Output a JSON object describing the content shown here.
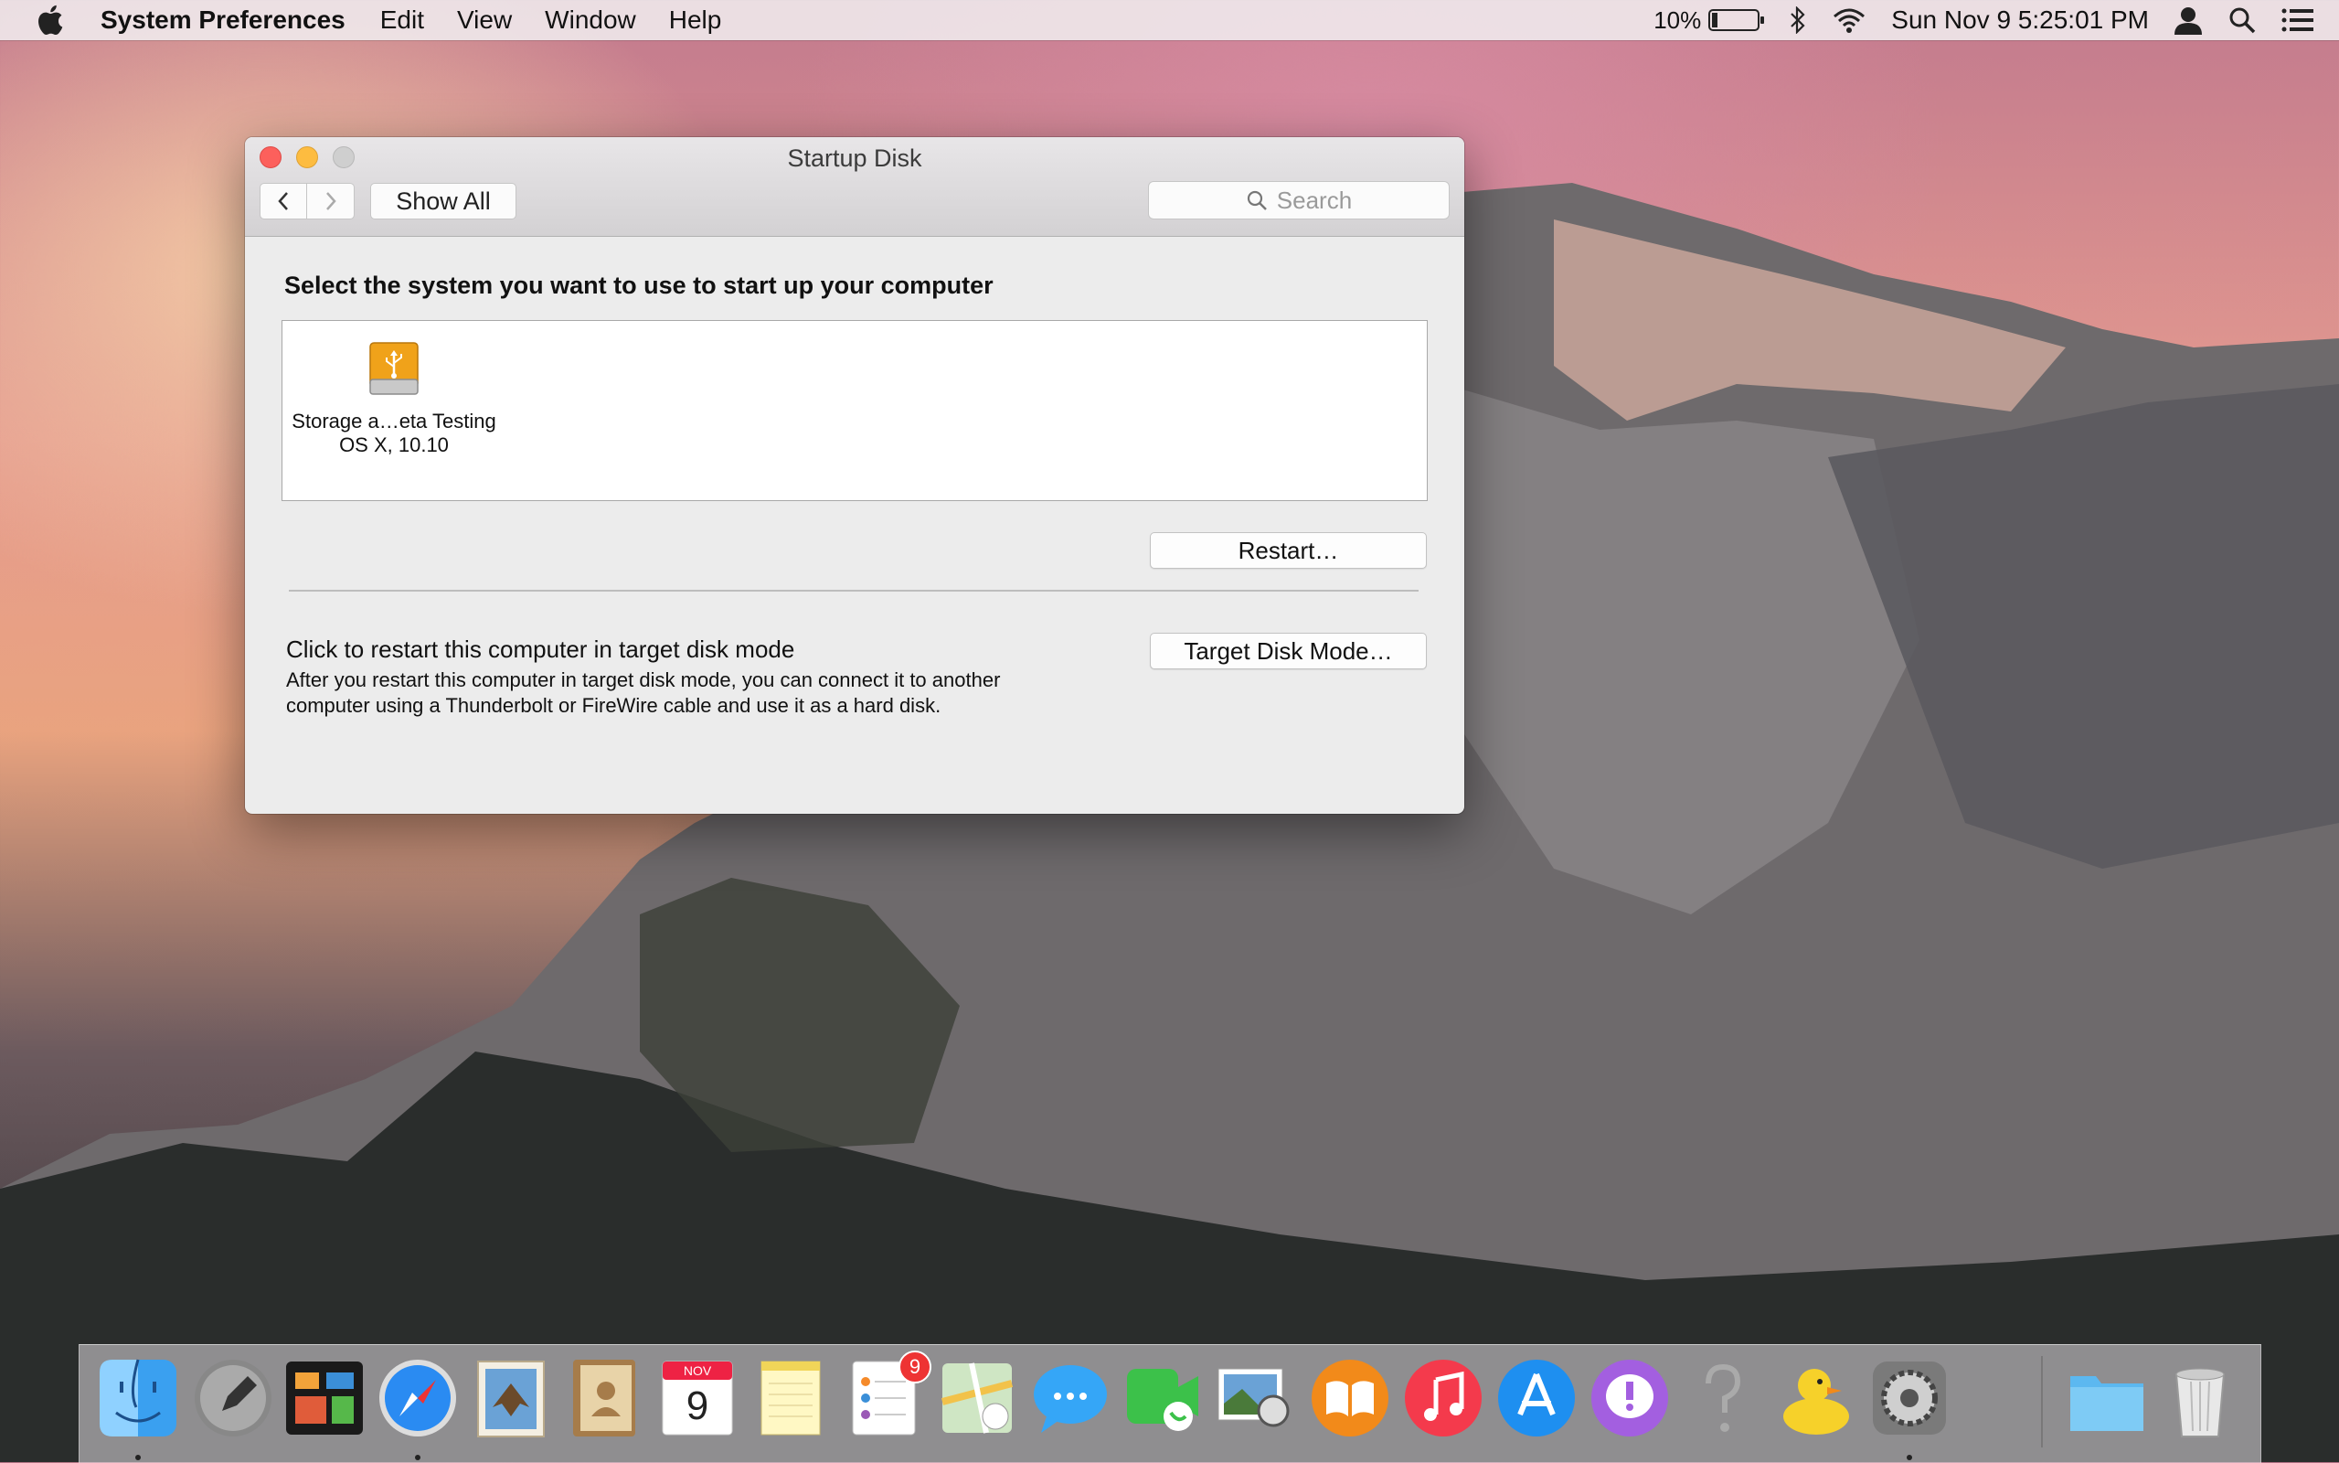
{
  "menubar": {
    "app_name": "System Preferences",
    "menus": [
      "Edit",
      "View",
      "Window",
      "Help"
    ],
    "battery_percent": "10%",
    "datetime": "Sun Nov 9  5:25:01 PM"
  },
  "window": {
    "title": "Startup Disk",
    "show_all": "Show All",
    "search_placeholder": "Search",
    "heading": "Select the system you want to use to start up your computer",
    "disk": {
      "name_line1": "Storage a…eta Testing",
      "name_line2": "OS X, 10.10"
    },
    "restart_button": "Restart…",
    "tdm_title": "Click to restart this computer in target disk mode",
    "tdm_description": "After you restart this computer in target disk mode, you can connect it to another computer using a Thunderbolt or FireWire cable and use it as a hard disk.",
    "tdm_button": "Target Disk Mode…"
  },
  "dock": {
    "calendar_month": "NOV",
    "calendar_day": "9",
    "reminders_badge": "9",
    "items": [
      "finder-icon",
      "launchpad-icon",
      "mission-control-icon",
      "safari-icon",
      "mail-icon",
      "contacts-icon",
      "calendar-icon",
      "notes-icon",
      "reminders-icon",
      "maps-icon",
      "messages-icon",
      "facetime-icon",
      "preview-icon",
      "ibooks-icon",
      "itunes-icon",
      "app-store-icon",
      "feedback-assistant-icon",
      "help-icon",
      "cyberduck-icon",
      "system-preferences-icon",
      "downloads-folder-icon",
      "trash-icon"
    ]
  }
}
